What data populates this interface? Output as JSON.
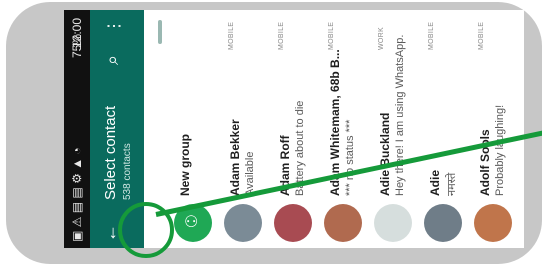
{
  "status_bar": {
    "text": "12:00",
    "battery": "75%"
  },
  "app_bar": {
    "title": "Select contact",
    "subtitle": "538 contacts",
    "back_icon": "←",
    "search_icon": "⌕",
    "menu_icon": "⋮"
  },
  "contacts": [
    {
      "name": "New group",
      "status": "",
      "type": "",
      "avatar_color": "#1fa855",
      "avatar_icon": "people-add-icon"
    },
    {
      "name": "Adam Bekker",
      "status": "Available",
      "type": "MOBILE",
      "avatar_color": "#7b8b96"
    },
    {
      "name": "Adam Roff",
      "status": "Battery about to die",
      "type": "MOBILE",
      "avatar_color": "#a84b52"
    },
    {
      "name": "Adam Whitemam, 68b B...",
      "status": "*** no status ***",
      "type": "MOBILE",
      "avatar_color": "#b06a4f"
    },
    {
      "name": "Adie Buckland",
      "status": "Hey there! I am using WhatsApp.",
      "type": "WORK",
      "avatar_color": "#d6dedd"
    },
    {
      "name": "Adie",
      "status": "नमस्ते",
      "type": "MOBILE",
      "avatar_color": "#6f7d88"
    },
    {
      "name": "Adolf Sools",
      "status": "Probably laughing!",
      "type": "MOBILE",
      "avatar_color": "#c0754b"
    },
    {
      "name": "",
      "status": "",
      "type": "",
      "avatar_color": "#3c3c3c"
    }
  ],
  "annotation_color": "#159a3a"
}
